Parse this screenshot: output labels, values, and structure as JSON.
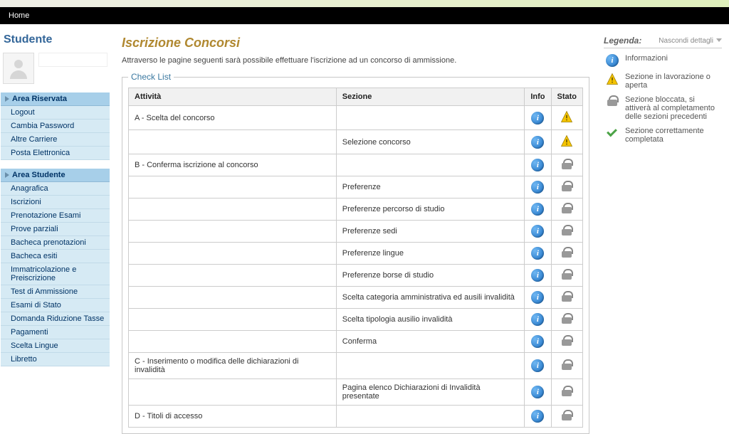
{
  "topbar": {
    "home": "Home"
  },
  "sidebar": {
    "title": "Studente",
    "sections": [
      {
        "header": "Area Riservata",
        "items": [
          {
            "label": "Logout"
          },
          {
            "label": "Cambia Password"
          },
          {
            "label": "Altre Carriere"
          },
          {
            "label": "Posta Elettronica"
          }
        ]
      },
      {
        "header": "Area Studente",
        "items": [
          {
            "label": "Anagrafica"
          },
          {
            "label": "Iscrizioni"
          },
          {
            "label": "Prenotazione Esami"
          },
          {
            "label": "Prove parziali"
          },
          {
            "label": "Bacheca prenotazioni"
          },
          {
            "label": "Bacheca esiti"
          },
          {
            "label": "Immatricolazione e Preiscrizione"
          },
          {
            "label": "Test di Ammissione"
          },
          {
            "label": "Esami di Stato"
          },
          {
            "label": "Domanda Riduzione Tasse"
          },
          {
            "label": "Pagamenti"
          },
          {
            "label": "Scelta Lingue"
          },
          {
            "label": "Libretto"
          }
        ]
      }
    ]
  },
  "page": {
    "title": "Iscrizione Concorsi",
    "description": "Attraverso le pagine seguenti sarà possibile effettuare l'iscrizione ad un concorso di ammissione.",
    "checklist_legend": "Check List"
  },
  "table": {
    "headers": {
      "attivita": "Attività",
      "sezione": "Sezione",
      "info": "Info",
      "stato": "Stato"
    },
    "rows": [
      {
        "attivita": "A - Scelta del concorso",
        "sezione": "",
        "info": "info",
        "stato": "warn"
      },
      {
        "attivita": "",
        "sezione": "Selezione concorso",
        "info": "info",
        "stato": "warn"
      },
      {
        "attivita": "B - Conferma iscrizione al concorso",
        "sezione": "",
        "info": "info",
        "stato": "lock"
      },
      {
        "attivita": "",
        "sezione": "Preferenze",
        "info": "info",
        "stato": "lock"
      },
      {
        "attivita": "",
        "sezione": "Preferenze percorso di studio",
        "info": "info",
        "stato": "lock"
      },
      {
        "attivita": "",
        "sezione": "Preferenze sedi",
        "info": "info",
        "stato": "lock"
      },
      {
        "attivita": "",
        "sezione": "Preferenze lingue",
        "info": "info",
        "stato": "lock"
      },
      {
        "attivita": "",
        "sezione": "Preferenze borse di studio",
        "info": "info",
        "stato": "lock"
      },
      {
        "attivita": "",
        "sezione": "Scelta categoria amministrativa ed ausili invalidità",
        "info": "info",
        "stato": "lock"
      },
      {
        "attivita": "",
        "sezione": "Scelta tipologia ausilio invalidità",
        "info": "info",
        "stato": "lock"
      },
      {
        "attivita": "",
        "sezione": "Conferma",
        "info": "info",
        "stato": "lock"
      },
      {
        "attivita": "C - Inserimento o modifica delle dichiarazioni di invalidità",
        "sezione": "",
        "info": "info",
        "stato": "lock"
      },
      {
        "attivita": "",
        "sezione": "Pagina elenco Dichiarazioni di Invalidità presentate",
        "info": "info",
        "stato": "lock"
      },
      {
        "attivita": "D - Titoli di accesso",
        "sezione": "",
        "info": "info",
        "stato": "lock"
      }
    ]
  },
  "legend": {
    "title": "Legenda:",
    "toggle": "Nascondi dettagli",
    "items": [
      {
        "icon": "info",
        "text": "Informazioni"
      },
      {
        "icon": "warn",
        "text": "Sezione in lavorazione o aperta"
      },
      {
        "icon": "lock",
        "text": "Sezione bloccata, si attiverà al completamento delle sezioni precedenti"
      },
      {
        "icon": "check",
        "text": "Sezione correttamente completata"
      }
    ]
  }
}
